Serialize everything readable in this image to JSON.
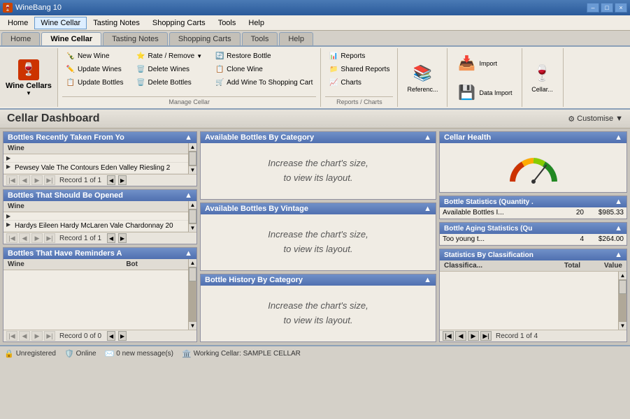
{
  "titleBar": {
    "title": "WineBang 10",
    "icon": "🍷",
    "controls": [
      "–",
      "□",
      "×"
    ]
  },
  "menuBar": {
    "items": [
      "Home",
      "Wine Cellar",
      "Tasting Notes",
      "Shopping Carts",
      "Tools",
      "Help"
    ]
  },
  "ribbon": {
    "wineCellars": "Wine Cellars",
    "sections": {
      "manageCellar": {
        "label": "Manage Cellar",
        "buttons": [
          {
            "icon": "🍾",
            "label": "New Wine",
            "color": "green"
          },
          {
            "icon": "✏️",
            "label": "Update Wines",
            "color": "blue"
          },
          {
            "icon": "📋",
            "label": "Update Bottles",
            "color": "blue"
          },
          {
            "icon": "⭐",
            "label": "Rate / Remove",
            "color": "orange",
            "dropdown": true
          },
          {
            "icon": "🗑️",
            "label": "Delete Wines",
            "color": "red"
          },
          {
            "icon": "🗑️",
            "label": "Delete Bottles",
            "color": "red"
          },
          {
            "icon": "🔄",
            "label": "Restore Bottle",
            "color": "green"
          },
          {
            "icon": "📋",
            "label": "Clone Wine",
            "color": "blue"
          },
          {
            "icon": "🛒",
            "label": "Add Wine To Shopping Cart",
            "color": "green"
          }
        ]
      },
      "reportsCharts": {
        "label": "Reports / Charts",
        "buttons": [
          {
            "icon": "📊",
            "label": "Reports"
          },
          {
            "icon": "📁",
            "label": "Shared Reports"
          },
          {
            "icon": "📈",
            "label": "Charts"
          }
        ]
      },
      "reference": {
        "label": "Referenc...",
        "large": true
      },
      "import": {
        "label": "Import",
        "icon": "📥"
      },
      "dataImport": {
        "label": "Data Import",
        "icon": "💾"
      },
      "cellar": {
        "label": "Cellar...",
        "icon": "🍷"
      }
    }
  },
  "pageHeader": {
    "title": "Cellar Dashboard",
    "customise": "Customise"
  },
  "panels": {
    "bottlesRecentlyTaken": {
      "title": "Bottles Recently Taken From Yo",
      "columns": [
        "Wine"
      ],
      "rows": [
        {
          "cells": [
            "Pewsey Vale The Contours Eden Valley Riesling 2"
          ],
          "selected": false
        }
      ],
      "navText": "Record 1 of 1"
    },
    "bottlesShouldBeOpened": {
      "title": "Bottles That Should Be Opened",
      "columns": [
        "Wine"
      ],
      "rows": [
        {
          "cells": [
            "Hardys Eileen Hardy McLaren Vale Chardonnay 20"
          ],
          "selected": false
        }
      ],
      "navText": "Record 1 of 1"
    },
    "bottlesHaveReminders": {
      "title": "Bottles That Have Reminders A",
      "columns": [
        "Wine",
        "Bot"
      ],
      "rows": [],
      "navText": "Record 0 of 0"
    },
    "availableByCategory": {
      "title": "Available Bottles By Category",
      "chartMsg": "Increase the chart's size,\nto view its layout."
    },
    "availableByVintage": {
      "title": "Available Bottles By Vintage",
      "chartMsg": "Increase the chart's size,\nto view its layout."
    },
    "bottleHistoryByCategory": {
      "title": "Bottle History By Category",
      "chartMsg": "Increase the chart's size,\nto view its layout."
    },
    "cellarHealth": {
      "title": "Cellar Health"
    },
    "bottleStatistics": {
      "title": "Bottle Statistics (Quantity .",
      "rows": [
        {
          "label": "Available Bottles I...",
          "qty": "20",
          "value": "$985.33"
        }
      ],
      "navText": ""
    },
    "bottleAgingStatistics": {
      "title": "Bottle Aging Statistics  (Qu",
      "rows": [
        {
          "label": "Too young t...",
          "qty": "4",
          "value": "$264.00"
        }
      ]
    },
    "statisticsByClassification": {
      "title": "Statistics By Classification",
      "columns": [
        "Classifica...",
        "Total",
        "Value"
      ],
      "rows": [],
      "navText": "Record 1 of 4"
    }
  },
  "statusBar": {
    "unregistered": "Unregistered",
    "online": "Online",
    "messages": "0 new message(s)",
    "workingCellar": "Working Cellar: SAMPLE CELLAR"
  }
}
